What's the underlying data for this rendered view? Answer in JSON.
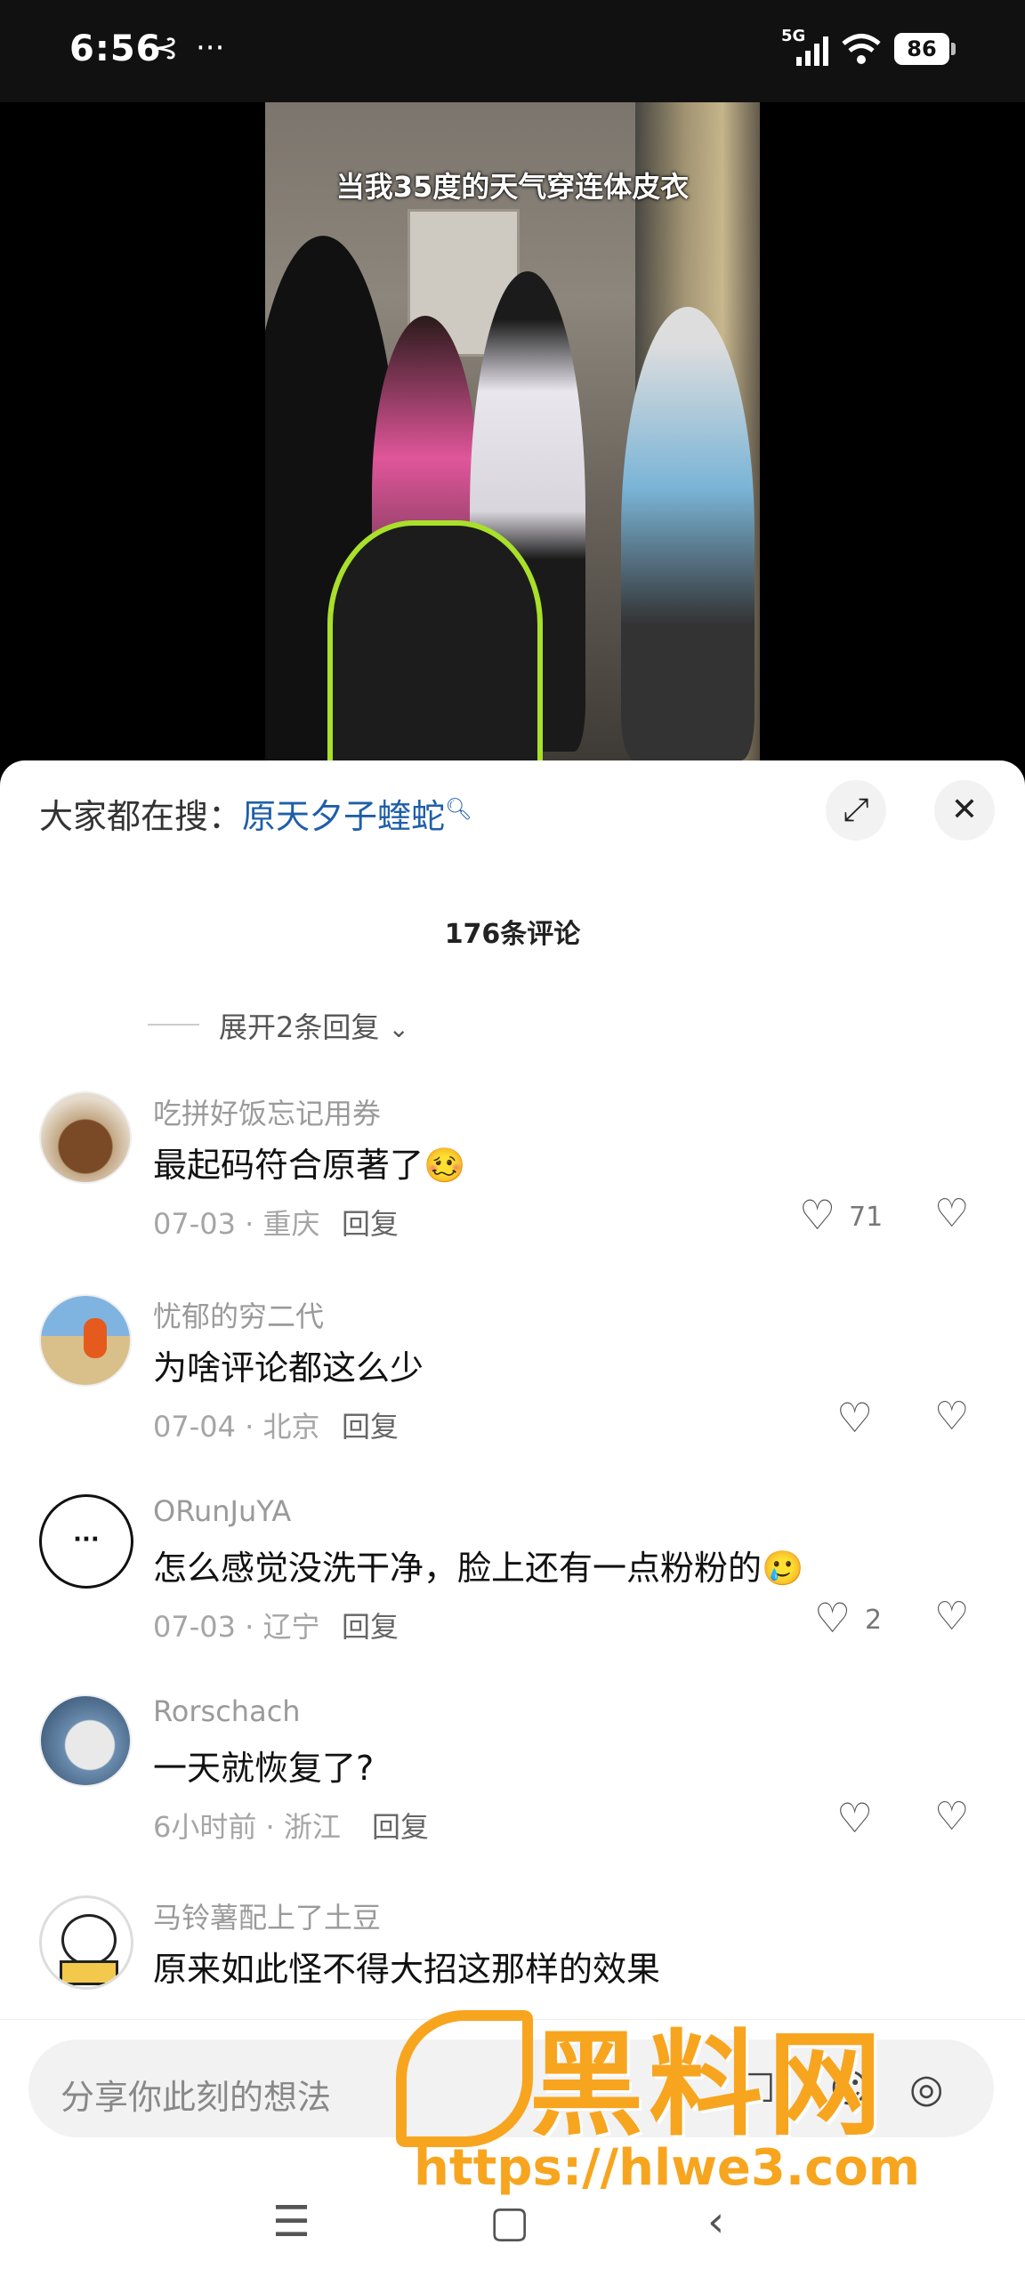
{
  "status_bar": {
    "time": "6:56",
    "network": "5G",
    "battery": "86"
  },
  "video": {
    "caption": "当我35度的天气穿连体皮衣"
  },
  "sheet": {
    "search_prefix": "大家都在搜：",
    "search_term": "原天夕子蝰蛇",
    "comment_count": "176条评论",
    "expand_replies": "展开2条回复"
  },
  "comments": [
    {
      "user": "吃拼好饭忘记用券",
      "text": "最起码符合原著了🥴",
      "date_loc": "07-03 · 重庆",
      "reply": "回复",
      "likes": "71"
    },
    {
      "user": "忧郁的穷二代",
      "text": "为啥评论都这么少",
      "date_loc": "07-04 · 北京",
      "reply": "回复",
      "likes": ""
    },
    {
      "user": "ORunJuYA",
      "text": "怎么感觉没洗干净，脸上还有一点粉粉的🥲",
      "date_loc": "07-03 · 辽宁",
      "reply": "回复",
      "likes": "2"
    },
    {
      "user": "Rorschach",
      "text": "一天就恢复了?",
      "date_loc": "6小时前 · 浙江",
      "reply": "回复",
      "likes": ""
    },
    {
      "user": "马铃薯配上了土豆",
      "text": "原来如此怪不得大招这那样的效果",
      "date_loc": "",
      "reply": "",
      "likes": ""
    }
  ],
  "input": {
    "placeholder": "分享你此刻的想法"
  },
  "watermark": {
    "brand": "黑料网",
    "url": "https://hlwe3.com"
  }
}
